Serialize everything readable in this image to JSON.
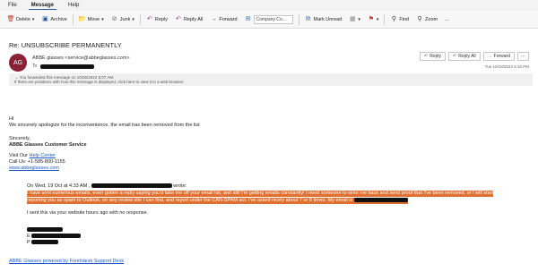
{
  "menubar": {
    "items": [
      "File",
      "Message",
      "Help"
    ]
  },
  "ribbon": {
    "delete": "Delete",
    "archive": "Archive",
    "move": "Move",
    "junk": "Junk",
    "reply": "Reply",
    "reply_all": "Reply All",
    "forward": "Forward",
    "quick_steps": "Company Co...",
    "mark_unread": "Mark Unread",
    "find": "Find",
    "zoom": "Zoom",
    "more": "..."
  },
  "message": {
    "subject": "Re: UNSUBSCRIBE PERMANENTLY",
    "avatar_initials": "AG",
    "from": "ABBE glasses <service@abbeglasses.com>",
    "to_label": "To",
    "reply_label": "Reply",
    "reply_all_label": "Reply All",
    "forward_label": "Forward",
    "timestamp": "Tue 10/18/2022 6:16 PM",
    "info_line1": "You forwarded this message on 10/25/2022 5:07 AM.",
    "info_line2": "If there are problems with how this message is displayed, click here to view it in a web browser."
  },
  "body": {
    "greeting": "Hi",
    "line1": "We sincerely apologize for the inconvenience, the email has been removed from the list",
    "sincerely": "Sincerely,",
    "signature": "ABBE Glasses Customer Service",
    "visit_prefix": "Visit Our ",
    "help_center": "Help Center",
    "call": "Call Us: +1-585-800-1155",
    "website": "www.abbeglasses.com",
    "quote_prefix": "On Wed, 19 Oct at 4:33 AM ,",
    "quote_suffix": "wrote:",
    "hl_line1": "I have sent numerous emails, even gotten a reply saying you'd take me off your email list, and still I'm getting emails constantly! I need someone to write me back and send proof that I've been removed, or I will start",
    "hl_line2": "reporting you as spam to Outlook, on any review site I can find, and report under the CAN-SPAM act. I've asked nicely about 7 or 8 times. My email is",
    "sent_via": "I sent this via your website hours ago with no response.",
    "sig_e": "E",
    "sig_p": "P",
    "footer_link": "ABBE Glasses powered by Freshdesk Support Desk"
  },
  "colors": {
    "highlight": "#e07030",
    "link": "#1a5cc8",
    "avatar": "#8b2136",
    "accent": "#2b579a"
  }
}
